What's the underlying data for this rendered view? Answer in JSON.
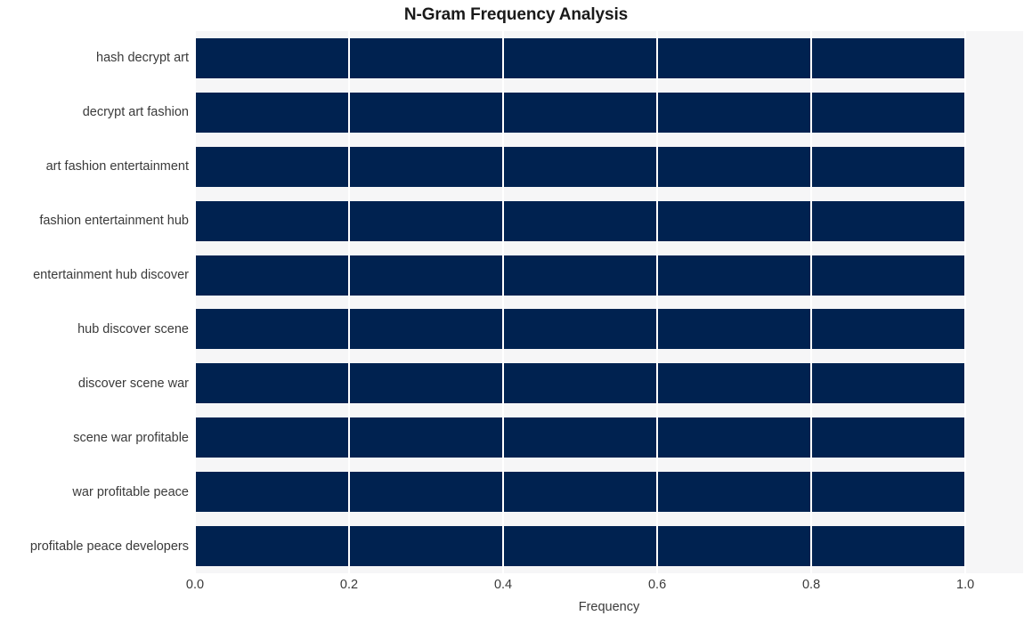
{
  "chart_data": {
    "type": "bar",
    "orientation": "horizontal",
    "title": "N-Gram Frequency Analysis",
    "xlabel": "Frequency",
    "ylabel": "",
    "categories": [
      "hash decrypt art",
      "decrypt art fashion",
      "art fashion entertainment",
      "fashion entertainment hub",
      "entertainment hub discover",
      "hub discover scene",
      "discover scene war",
      "scene war profitable",
      "war profitable peace",
      "profitable peace developers"
    ],
    "values": [
      1.0,
      1.0,
      1.0,
      1.0,
      1.0,
      1.0,
      1.0,
      1.0,
      1.0,
      1.0
    ],
    "xlim": [
      0.0,
      1.075
    ],
    "xticks": [
      0.0,
      0.2,
      0.4,
      0.6,
      0.8,
      1.0
    ],
    "xtick_labels": [
      "0.0",
      "0.2",
      "0.4",
      "0.6",
      "0.8",
      "1.0"
    ],
    "ytick_labels": [
      "hash decrypt art",
      "decrypt art fashion",
      "art fashion entertainment",
      "fashion entertainment hub",
      "entertainment hub discover",
      "hub discover scene",
      "discover scene war",
      "scene war profitable",
      "war profitable peace",
      "profitable peace developers"
    ],
    "bar_color": "#002250",
    "plot_background": "#f6f6f7",
    "figure_background": "#ffffff",
    "gridline_color": "#ffffff",
    "grid": "x-only",
    "legend": null,
    "legend_position": "none"
  }
}
